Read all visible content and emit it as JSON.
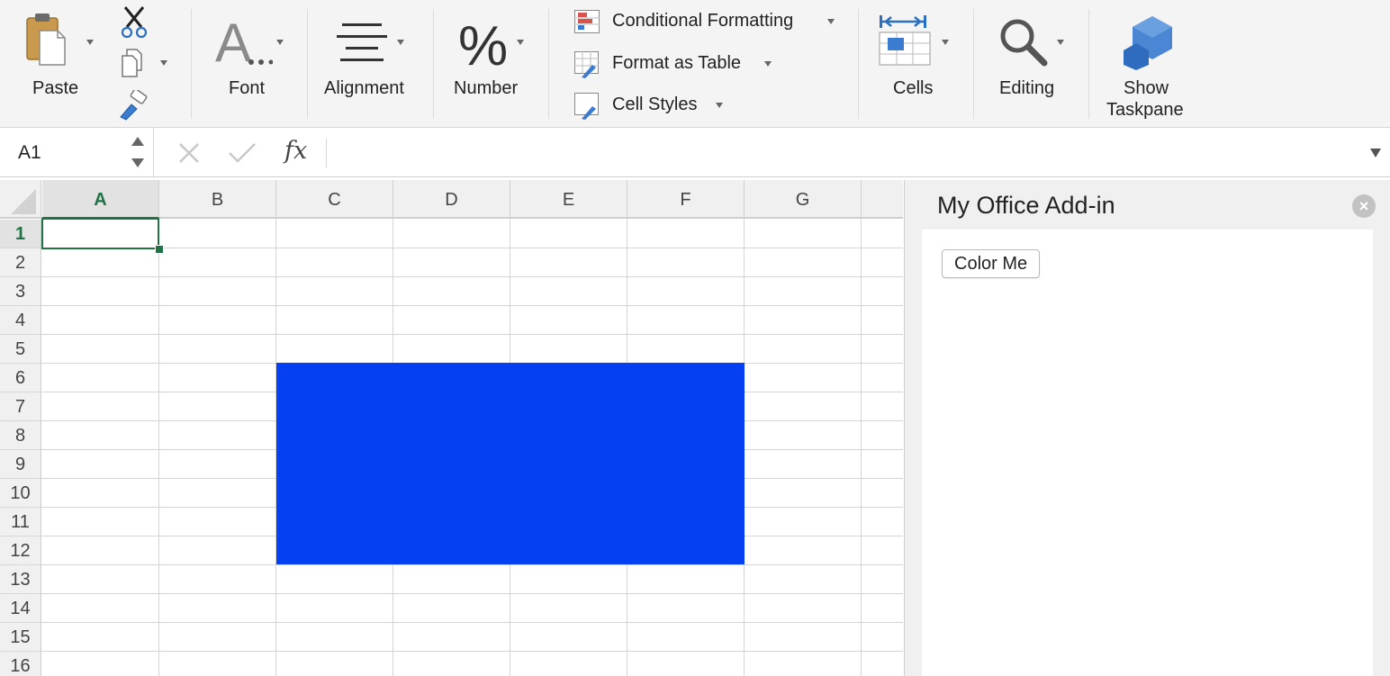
{
  "ribbon": {
    "paste_label": "Paste",
    "font_label": "Font",
    "alignment_label": "Alignment",
    "number_label": "Number",
    "conditional_formatting_label": "Conditional Formatting",
    "format_as_table_label": "Format as Table",
    "cell_styles_label": "Cell Styles",
    "cells_label": "Cells",
    "editing_label": "Editing",
    "show_taskpane_label_line1": "Show",
    "show_taskpane_label_line2": "Taskpane",
    "icons": [
      "paste-icon",
      "cut-icon",
      "copy-icon",
      "format-painter-icon",
      "font-icon",
      "alignment-icon",
      "number-icon",
      "conditional-formatting-icon",
      "format-as-table-icon",
      "cell-styles-icon",
      "cells-icon",
      "editing-icon",
      "add-in-icon"
    ]
  },
  "formula_bar": {
    "name_box_value": "A1",
    "fx_label": "fx",
    "formula_value": ""
  },
  "sheet": {
    "columns": [
      "A",
      "B",
      "C",
      "D",
      "E",
      "F",
      "G"
    ],
    "rows": [
      "1",
      "2",
      "3",
      "4",
      "5",
      "6",
      "7",
      "8",
      "9",
      "10",
      "11",
      "12",
      "13",
      "14",
      "15",
      "16"
    ],
    "selected_cell": "A1",
    "filled_range": "C6:F12",
    "fill_color": "#0540F2",
    "accent_color": "#217346"
  },
  "taskpane": {
    "title": "My Office Add-in",
    "button_label": "Color Me"
  }
}
